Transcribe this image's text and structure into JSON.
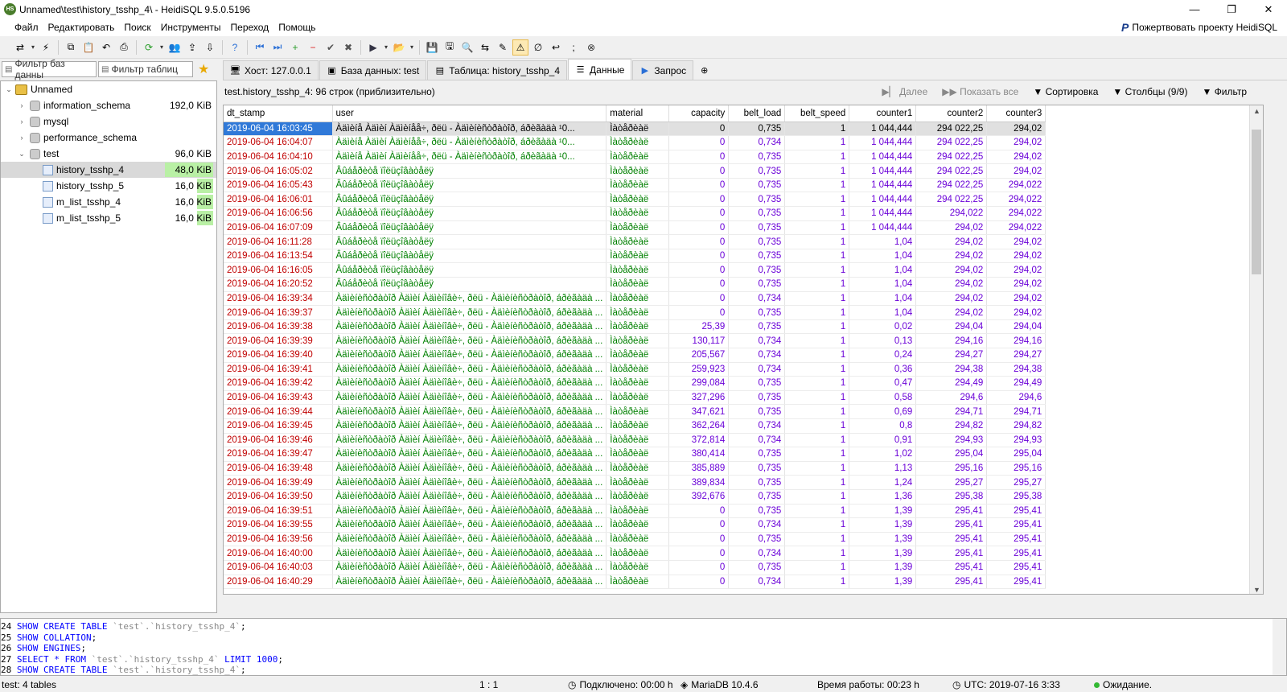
{
  "window": {
    "title": "Unnamed\\test\\history_tsshp_4\\ - HeidiSQL 9.5.0.5196",
    "app_icon": "HS",
    "minimize": "—",
    "maximize": "❐",
    "close": "✕"
  },
  "menu": {
    "items": [
      "Файл",
      "Редактировать",
      "Поиск",
      "Инструменты",
      "Переход",
      "Помощь"
    ],
    "donate": "Пожертвовать проекту HeidiSQL"
  },
  "toolbar": {
    "icons": [
      "connect-icon",
      "dropdown-arrow-icon",
      "disconnect-icon",
      "copy-icon",
      "paste-icon",
      "undo-icon",
      "print-icon",
      "refresh-icon",
      "dropdown-arrow-icon",
      "user-manager-icon",
      "export-icon",
      "import-icon",
      "help-icon",
      "first-icon",
      "last-icon",
      "add-icon",
      "delete-icon",
      "post-icon",
      "cancel-icon",
      "run-icon",
      "dropdown-arrow-icon",
      "open-file-icon",
      "dropdown-arrow-icon",
      "save-icon",
      "save-as-icon",
      "find-icon",
      "replace-icon",
      "edit-icon",
      "warning-filter-icon",
      "null-icon",
      "wrap-icon",
      "semicolon-icon",
      "stop-icon"
    ]
  },
  "left_panel": {
    "filter_db": "Фильтр баз данны",
    "filter_tables": "Фильтр таблиц",
    "tree": [
      {
        "label": "Unnamed",
        "level": 0,
        "type": "server",
        "expanded": true,
        "size": ""
      },
      {
        "label": "information_schema",
        "level": 1,
        "type": "db",
        "expanded": false,
        "size": "192,0 KiB"
      },
      {
        "label": "mysql",
        "level": 1,
        "type": "db",
        "expanded": false,
        "size": ""
      },
      {
        "label": "performance_schema",
        "level": 1,
        "type": "db",
        "expanded": false,
        "size": ""
      },
      {
        "label": "test",
        "level": 1,
        "type": "db",
        "expanded": true,
        "size": "96,0 KiB"
      },
      {
        "label": "history_tsshp_4",
        "level": 2,
        "type": "table",
        "size": "48,0 KiB",
        "selected": true,
        "fill": 1.0
      },
      {
        "label": "history_tsshp_5",
        "level": 2,
        "type": "table",
        "size": "16,0 KiB",
        "fill": 0.33
      },
      {
        "label": "m_list_tsshp_4",
        "level": 2,
        "type": "table",
        "size": "16,0 KiB",
        "fill": 0.33
      },
      {
        "label": "m_list_tsshp_5",
        "level": 2,
        "type": "table",
        "size": "16,0 KiB",
        "fill": 0.33
      }
    ]
  },
  "tabs": [
    {
      "label": "Хост: 127.0.0.1",
      "icon": "host-icon",
      "active": false
    },
    {
      "label": "База данных: test",
      "icon": "database-icon",
      "active": false
    },
    {
      "label": "Таблица: history_tsshp_4",
      "icon": "table-icon",
      "active": false
    },
    {
      "label": "Данные",
      "icon": "data-icon",
      "active": true
    },
    {
      "label": "Запрос",
      "icon": "query-icon",
      "active": false
    }
  ],
  "data_header": {
    "info": "test.history_tsshp_4: 96 строк (приблизительно)",
    "next": "Далее",
    "show_all": "Показать все",
    "sort": "Сортировка",
    "columns": "Столбцы (9/9)",
    "filter": "Фильтр"
  },
  "grid": {
    "columns": [
      "dt_stamp",
      "user",
      "material",
      "capacity",
      "belt_load",
      "belt_speed",
      "counter1",
      "counter2",
      "counter3"
    ],
    "rows": [
      [
        "2019-06-04 16:03:45",
        "Àäìèíå Àäìèí Àäìèíåå÷, ðëü - Àäìèíèñòðàòîð, áðèãàäà ¹0...",
        "Ìàòåðèàë",
        "0",
        "0,735",
        "1",
        "1 044,444",
        "294 022,25",
        "294,02"
      ],
      [
        "2019-06-04 16:04:07",
        "Àäìèíå Àäìèí Àäìèíåå÷, ðëü - Àäìèíèñòðàòîð, áðèãàäà ¹0...",
        "Ìàòåðèàë",
        "0",
        "0,734",
        "1",
        "1 044,444",
        "294 022,25",
        "294,02"
      ],
      [
        "2019-06-04 16:04:10",
        "Àäìèíå Àäìèí Àäìèíåå÷, ðëü - Àäìèíèñòðàòîð, áðèãàäà ¹0...",
        "Ìàòåðèàë",
        "0",
        "0,735",
        "1",
        "1 044,444",
        "294 022,25",
        "294,02"
      ],
      [
        "2019-06-04 16:05:02",
        "Âûáåðèòå ïîëüçîâàòåëÿ",
        "Ìàòåðèàë",
        "0",
        "0,735",
        "1",
        "1 044,444",
        "294 022,25",
        "294,02"
      ],
      [
        "2019-06-04 16:05:43",
        "Âûáåðèòå ïîëüçîâàòåëÿ",
        "Ìàòåðèàë",
        "0",
        "0,735",
        "1",
        "1 044,444",
        "294 022,25",
        "294,022"
      ],
      [
        "2019-06-04 16:06:01",
        "Âûáåðèòå ïîëüçîâàòåëÿ",
        "Ìàòåðèàë",
        "0",
        "0,735",
        "1",
        "1 044,444",
        "294 022,25",
        "294,022"
      ],
      [
        "2019-06-04 16:06:56",
        "Âûáåðèòå ïîëüçîâàòåëÿ",
        "Ìàòåðèàë",
        "0",
        "0,735",
        "1",
        "1 044,444",
        "294,022",
        "294,022"
      ],
      [
        "2019-06-04 16:07:09",
        "Âûáåðèòå ïîëüçîâàòåëÿ",
        "Ìàòåðèàë",
        "0",
        "0,735",
        "1",
        "1 044,444",
        "294,02",
        "294,022"
      ],
      [
        "2019-06-04 16:11:28",
        "Âûáåðèòå ïîëüçîâàòåëÿ",
        "Ìàòåðèàë",
        "0",
        "0,735",
        "1",
        "1,04",
        "294,02",
        "294,02"
      ],
      [
        "2019-06-04 16:13:54",
        "Âûáåðèòå ïîëüçîâàòåëÿ",
        "Ìàòåðèàë",
        "0",
        "0,735",
        "1",
        "1,04",
        "294,02",
        "294,02"
      ],
      [
        "2019-06-04 16:16:05",
        "Âûáåðèòå ïîëüçîâàòåëÿ",
        "Ìàòåðèàë",
        "0",
        "0,735",
        "1",
        "1,04",
        "294,02",
        "294,02"
      ],
      [
        "2019-06-04 16:20:52",
        "Âûáåðèòå ïîëüçîâàòåëÿ",
        "Ìàòåðèàë",
        "0",
        "0,735",
        "1",
        "1,04",
        "294,02",
        "294,02"
      ],
      [
        "2019-06-04 16:39:34",
        "Àäìèíèñòðàòîð Àäìèí Àäìèíîâè÷, ðëü - Àäìèíèñòðàòîð, áðèãàäà ...",
        "Ìàòåðèàë",
        "0",
        "0,734",
        "1",
        "1,04",
        "294,02",
        "294,02"
      ],
      [
        "2019-06-04 16:39:37",
        "Àäìèíèñòðàòîð Àäìèí Àäìèíîâè÷, ðëü - Àäìèíèñòðàòîð, áðèãàäà ...",
        "Ìàòåðèàë",
        "0",
        "0,735",
        "1",
        "1,04",
        "294,02",
        "294,02"
      ],
      [
        "2019-06-04 16:39:38",
        "Àäìèíèñòðàòîð Àäìèí Àäìèíîâè÷, ðëü - Àäìèíèñòðàòîð, áðèãàäà ...",
        "Ìàòåðèàë",
        "25,39",
        "0,735",
        "1",
        "0,02",
        "294,04",
        "294,04"
      ],
      [
        "2019-06-04 16:39:39",
        "Àäìèíèñòðàòîð Àäìèí Àäìèíîâè÷, ðëü - Àäìèíèñòðàòîð, áðèãàäà ...",
        "Ìàòåðèàë",
        "130,117",
        "0,734",
        "1",
        "0,13",
        "294,16",
        "294,16"
      ],
      [
        "2019-06-04 16:39:40",
        "Àäìèíèñòðàòîð Àäìèí Àäìèíîâè÷, ðëü - Àäìèíèñòðàòîð, áðèãàäà ...",
        "Ìàòåðèàë",
        "205,567",
        "0,734",
        "1",
        "0,24",
        "294,27",
        "294,27"
      ],
      [
        "2019-06-04 16:39:41",
        "Àäìèíèñòðàòîð Àäìèí Àäìèíîâè÷, ðëü - Àäìèíèñòðàòîð, áðèãàäà ...",
        "Ìàòåðèàë",
        "259,923",
        "0,734",
        "1",
        "0,36",
        "294,38",
        "294,38"
      ],
      [
        "2019-06-04 16:39:42",
        "Àäìèíèñòðàòîð Àäìèí Àäìèíîâè÷, ðëü - Àäìèíèñòðàòîð, áðèãàäà ...",
        "Ìàòåðèàë",
        "299,084",
        "0,735",
        "1",
        "0,47",
        "294,49",
        "294,49"
      ],
      [
        "2019-06-04 16:39:43",
        "Àäìèíèñòðàòîð Àäìèí Àäìèíîâè÷, ðëü - Àäìèíèñòðàòîð, áðèãàäà ...",
        "Ìàòåðèàë",
        "327,296",
        "0,735",
        "1",
        "0,58",
        "294,6",
        "294,6"
      ],
      [
        "2019-06-04 16:39:44",
        "Àäìèíèñòðàòîð Àäìèí Àäìèíîâè÷, ðëü - Àäìèíèñòðàòîð, áðèãàäà ...",
        "Ìàòåðèàë",
        "347,621",
        "0,735",
        "1",
        "0,69",
        "294,71",
        "294,71"
      ],
      [
        "2019-06-04 16:39:45",
        "Àäìèíèñòðàòîð Àäìèí Àäìèíîâè÷, ðëü - Àäìèíèñòðàòîð, áðèãàäà ...",
        "Ìàòåðèàë",
        "362,264",
        "0,734",
        "1",
        "0,8",
        "294,82",
        "294,82"
      ],
      [
        "2019-06-04 16:39:46",
        "Àäìèíèñòðàòîð Àäìèí Àäìèíîâè÷, ðëü - Àäìèíèñòðàòîð, áðèãàäà ...",
        "Ìàòåðèàë",
        "372,814",
        "0,734",
        "1",
        "0,91",
        "294,93",
        "294,93"
      ],
      [
        "2019-06-04 16:39:47",
        "Àäìèíèñòðàòîð Àäìèí Àäìèíîâè÷, ðëü - Àäìèíèñòðàòîð, áðèãàäà ...",
        "Ìàòåðèàë",
        "380,414",
        "0,735",
        "1",
        "1,02",
        "295,04",
        "295,04"
      ],
      [
        "2019-06-04 16:39:48",
        "Àäìèíèñòðàòîð Àäìèí Àäìèíîâè÷, ðëü - Àäìèíèñòðàòîð, áðèãàäà ...",
        "Ìàòåðèàë",
        "385,889",
        "0,735",
        "1",
        "1,13",
        "295,16",
        "295,16"
      ],
      [
        "2019-06-04 16:39:49",
        "Àäìèíèñòðàòîð Àäìèí Àäìèíîâè÷, ðëü - Àäìèíèñòðàòîð, áðèãàäà ...",
        "Ìàòåðèàë",
        "389,834",
        "0,735",
        "1",
        "1,24",
        "295,27",
        "295,27"
      ],
      [
        "2019-06-04 16:39:50",
        "Àäìèíèñòðàòîð Àäìèí Àäìèíîâè÷, ðëü - Àäìèíèñòðàòîð, áðèãàäà ...",
        "Ìàòåðèàë",
        "392,676",
        "0,735",
        "1",
        "1,36",
        "295,38",
        "295,38"
      ],
      [
        "2019-06-04 16:39:51",
        "Àäìèíèñòðàòîð Àäìèí Àäìèíîâè÷, ðëü - Àäìèíèñòðàòîð, áðèãàäà ...",
        "Ìàòåðèàë",
        "0",
        "0,735",
        "1",
        "1,39",
        "295,41",
        "295,41"
      ],
      [
        "2019-06-04 16:39:55",
        "Àäìèíèñòðàòîð Àäìèí Àäìèíîâè÷, ðëü - Àäìèíèñòðàòîð, áðèãàäà ...",
        "Ìàòåðèàë",
        "0",
        "0,734",
        "1",
        "1,39",
        "295,41",
        "295,41"
      ],
      [
        "2019-06-04 16:39:56",
        "Àäìèíèñòðàòîð Àäìèí Àäìèíîâè÷, ðëü - Àäìèíèñòðàòîð, áðèãàäà ...",
        "Ìàòåðèàë",
        "0",
        "0,735",
        "1",
        "1,39",
        "295,41",
        "295,41"
      ],
      [
        "2019-06-04 16:40:00",
        "Àäìèíèñòðàòîð Àäìèí Àäìèíîâè÷, ðëü - Àäìèíèñòðàòîð, áðèãàäà ...",
        "Ìàòåðèàë",
        "0",
        "0,734",
        "1",
        "1,39",
        "295,41",
        "295,41"
      ],
      [
        "2019-06-04 16:40:03",
        "Àäìèíèñòðàòîð Àäìèí Àäìèíîâè÷, ðëü - Àäìèíèñòðàòîð, áðèãàäà ...",
        "Ìàòåðèàë",
        "0",
        "0,735",
        "1",
        "1,39",
        "295,41",
        "295,41"
      ],
      [
        "2019-06-04 16:40:29",
        "Àäìèíèñòðàòîð Àäìèí Àäìèíîâè÷, ðëü - Àäìèíèñòðàòîð, áðèãàäà ...",
        "Ìàòåðèàë",
        "0",
        "0,734",
        "1",
        "1,39",
        "295,41",
        "295,41"
      ]
    ],
    "selected_row": 0
  },
  "sql_log": [
    {
      "n": "24",
      "tokens": [
        [
          "kw",
          "SHOW CREATE TABLE "
        ],
        [
          "id",
          "`test`.`history_tsshp_4`"
        ],
        [
          "str",
          ";"
        ]
      ]
    },
    {
      "n": "25",
      "tokens": [
        [
          "kw",
          "SHOW COLLATION"
        ],
        [
          "str",
          ";"
        ]
      ]
    },
    {
      "n": "26",
      "tokens": [
        [
          "kw",
          "SHOW ENGINES"
        ],
        [
          "str",
          ";"
        ]
      ]
    },
    {
      "n": "27",
      "tokens": [
        [
          "kw",
          "SELECT * FROM "
        ],
        [
          "id",
          "`test`.`history_tsshp_4`"
        ],
        [
          "kw",
          " LIMIT "
        ],
        [
          "num",
          "1000"
        ],
        [
          "str",
          ";"
        ]
      ]
    },
    {
      "n": "28",
      "tokens": [
        [
          "kw",
          "SHOW CREATE TABLE "
        ],
        [
          "id",
          "`test`.`history_tsshp_4`"
        ],
        [
          "str",
          ";"
        ]
      ]
    }
  ],
  "status": {
    "tables": "test: 4 tables",
    "cursor": "1 : 1",
    "connected": "Подключено: 00:00 h",
    "server": "MariaDB 10.4.6",
    "uptime": "Время работы: 00:23 h",
    "utc": "UTC: 2019-07-16 3:33",
    "state": "Ожидание."
  },
  "colors": {
    "dt": "#c00000",
    "text": "#008000",
    "number": "#6a00d8",
    "selection": "#3079d8"
  }
}
